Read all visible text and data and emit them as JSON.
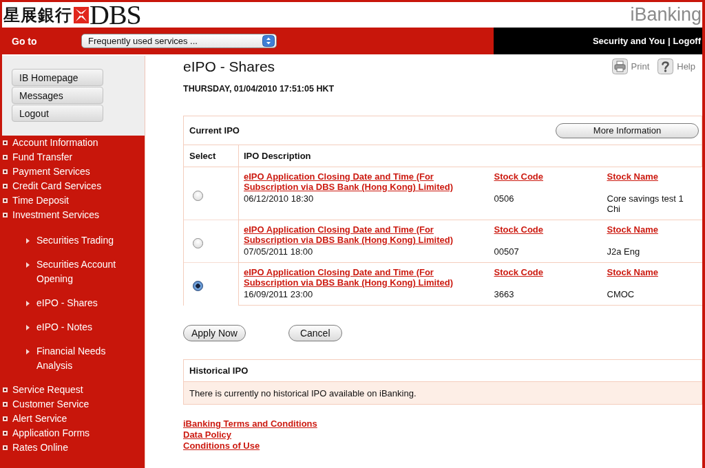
{
  "header": {
    "chinese_name": "星展銀行",
    "brand": "DBS",
    "product": "iBanking"
  },
  "navbar": {
    "goto_label": "Go to",
    "service_select": {
      "value": "Frequently used services ..."
    },
    "links": [
      {
        "label": "Security and You"
      },
      {
        "label": "Logoff"
      }
    ],
    "separator": "|"
  },
  "sidebar": {
    "buttons": [
      {
        "label": "IB Homepage"
      },
      {
        "label": "Messages"
      },
      {
        "label": "Logout"
      }
    ],
    "menu": [
      {
        "label": "Account Information"
      },
      {
        "label": "Fund Transfer"
      },
      {
        "label": "Payment Services"
      },
      {
        "label": "Credit Card Services"
      },
      {
        "label": "Time Deposit"
      },
      {
        "label": "Investment Services",
        "children": [
          {
            "label": "Securities Trading"
          },
          {
            "label": "Securities Account Opening"
          },
          {
            "label": "eIPO - Shares"
          },
          {
            "label": "eIPO - Notes"
          },
          {
            "label": "Financial Needs Analysis"
          }
        ]
      },
      {
        "label": "Service Request"
      },
      {
        "label": "Customer Service"
      },
      {
        "label": "Alert Service"
      },
      {
        "label": "Application Forms"
      },
      {
        "label": "Rates Online"
      }
    ]
  },
  "page": {
    "title": "eIPO - Shares",
    "timestamp": "THURSDAY, 01/04/2010 17:51:05 HKT",
    "tools": [
      {
        "kind": "print",
        "label": "Print"
      },
      {
        "kind": "help",
        "label": "Help"
      }
    ]
  },
  "current_ipo": {
    "title": "Current IPO",
    "more_button": "More Information",
    "columns": [
      "Select",
      "IPO Description"
    ],
    "rows": [
      {
        "selected": false,
        "closing_heading": "eIPO Application Closing Date and Time (For Subscription via DBS Bank (Hong Kong) Limited)",
        "closing": "06/12/2010 18:30",
        "code_heading": "Stock Code",
        "code": "0506",
        "name_heading": "Stock Name",
        "name": "Core savings test 1 Chi"
      },
      {
        "selected": false,
        "closing_heading": "eIPO Application Closing Date and Time (For Subscription via DBS Bank (Hong Kong) Limited)",
        "closing": "07/05/2011 18:00",
        "code_heading": "Stock Code",
        "code": "00507",
        "name_heading": "Stock Name",
        "name": "J2a Eng"
      },
      {
        "selected": true,
        "closing_heading": "eIPO Application Closing Date and Time (For Subscription via DBS Bank (Hong Kong) Limited)",
        "closing": "16/09/2011 23:00",
        "code_heading": "Stock Code",
        "code": "3663",
        "name_heading": "Stock Name",
        "name": "CMOC"
      }
    ]
  },
  "actions": [
    {
      "label": "Apply Now"
    },
    {
      "label": "Cancel"
    }
  ],
  "historical_ipo": {
    "title": "Historical IPO",
    "message": "There is currently no historical IPO available on iBanking."
  },
  "footer_links": [
    "iBanking Terms and Conditions",
    "Data Policy",
    "Conditions of Use"
  ]
}
